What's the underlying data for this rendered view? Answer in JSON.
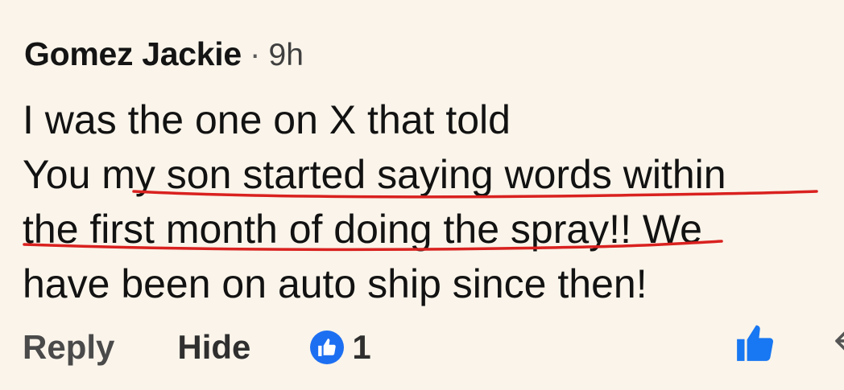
{
  "comment": {
    "author": "Gomez Jackie",
    "separator": "·",
    "timestamp": "9h",
    "body_lines": [
      "I was the one on X that told",
      "You my son started saying words within",
      "the first month of doing the spray!! We",
      "have been on auto ship since then!"
    ],
    "annotation_color": "#d9211f"
  },
  "actions": {
    "reply_label": "Reply",
    "hide_label": "Hide",
    "reaction_count": "1"
  },
  "icons": {
    "reaction": "thumbs-up-icon",
    "like": "thumbs-up-icon",
    "reply": "reply-icon"
  },
  "colors": {
    "background": "#faf4ea",
    "reaction_blue": "#1d6ff2",
    "like_blue": "#1877f2"
  }
}
